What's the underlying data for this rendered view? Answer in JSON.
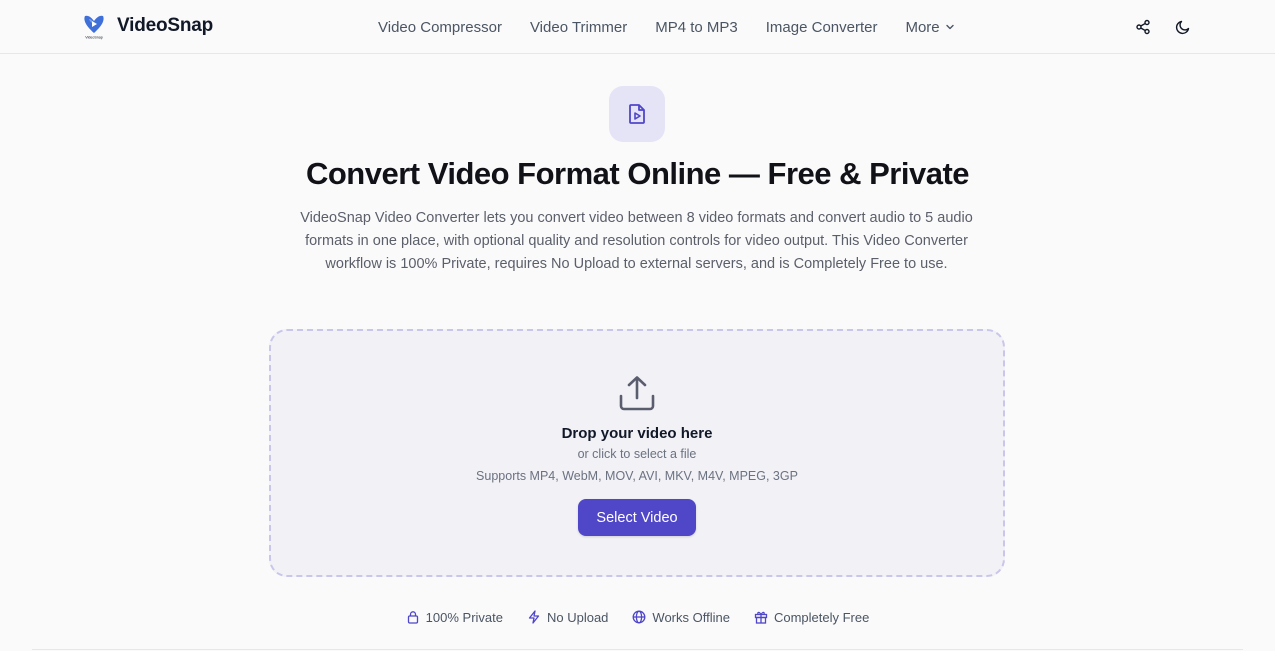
{
  "brand": {
    "name": "VideoSnap",
    "logo_caption": "VideoSnap",
    "accent": "#4f46c8"
  },
  "nav": {
    "items": [
      {
        "label": "Video Compressor"
      },
      {
        "label": "Video Trimmer"
      },
      {
        "label": "MP4 to MP3"
      },
      {
        "label": "Image Converter"
      }
    ],
    "more_label": "More"
  },
  "header_actions": {
    "share_icon": "share-icon",
    "theme_icon": "moon-icon"
  },
  "hero": {
    "icon": "file-video-icon",
    "title": "Convert Video Format Online — Free & Private",
    "description": "VideoSnap Video Converter lets you convert video between 8 video formats and convert audio to 5 audio formats in one place, with optional quality and resolution controls for video output. This Video Converter workflow is 100% Private, requires No Upload to external servers, and is Completely Free to use."
  },
  "dropzone": {
    "icon": "upload-icon",
    "title": "Drop your video here",
    "subtitle": "or click to select a file",
    "formats": "Supports MP4, WebM, MOV, AVI, MKV, M4V, MPEG, 3GP",
    "button_label": "Select Video"
  },
  "features": [
    {
      "icon": "lock-icon",
      "label": "100% Private"
    },
    {
      "icon": "zap-icon",
      "label": "No Upload"
    },
    {
      "icon": "globe-icon",
      "label": "Works Offline"
    },
    {
      "icon": "gift-icon",
      "label": "Completely Free"
    }
  ]
}
